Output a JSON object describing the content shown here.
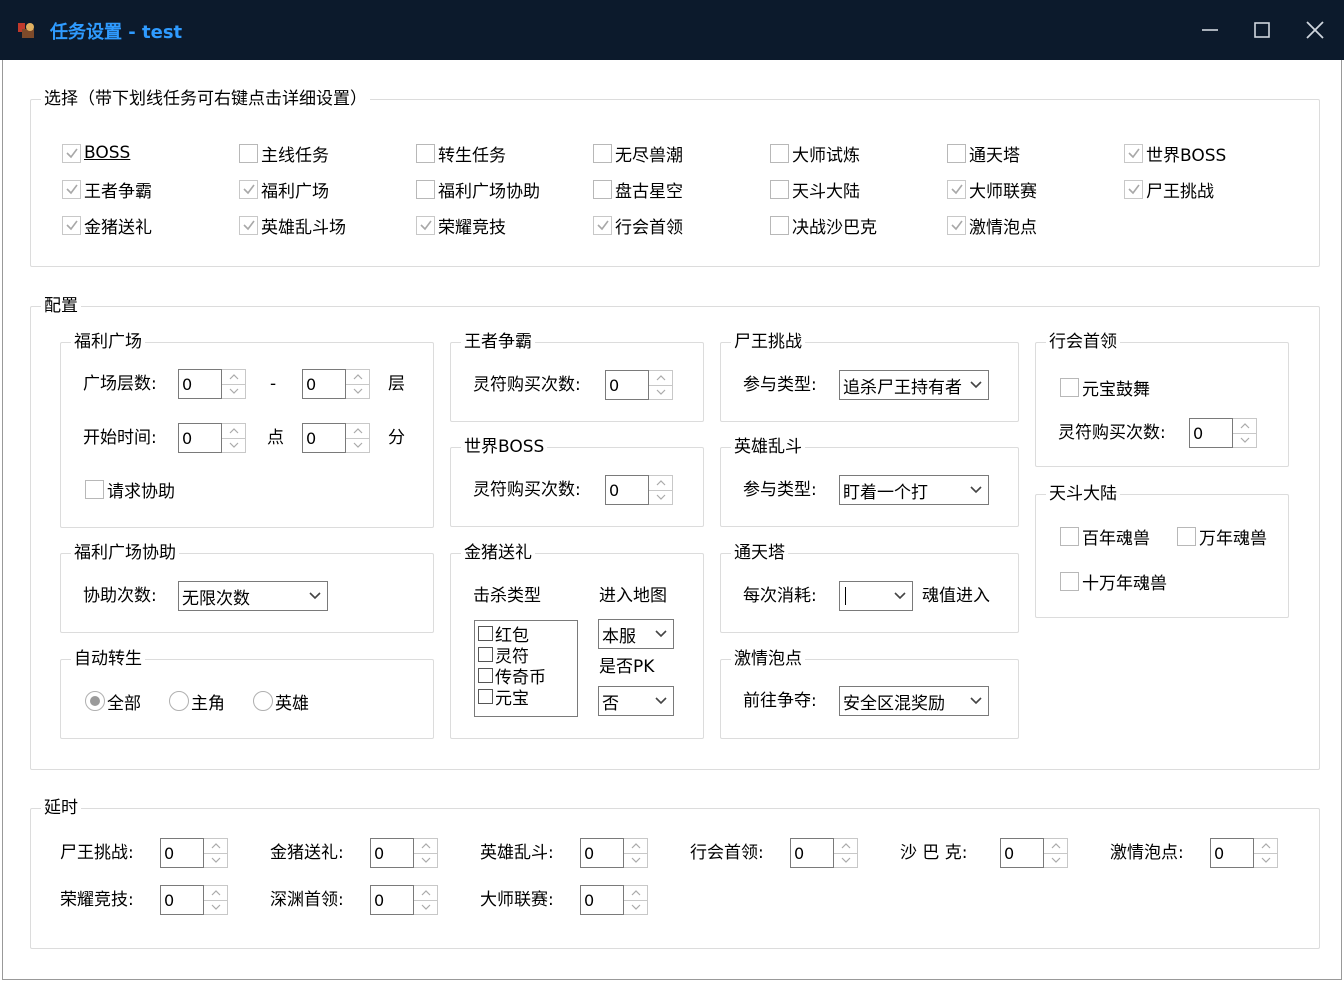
{
  "window": {
    "title": "任务设置 - test",
    "icons": {
      "app": "app-logo-icon",
      "minimize": "minimize-icon",
      "maximize": "maximize-icon",
      "close": "close-icon"
    }
  },
  "select_group": {
    "legend": "选择（带下划线任务可右键点击详细设置）",
    "tasks": [
      {
        "label": "BOSS",
        "checked": true,
        "underline": true
      },
      {
        "label": "主线任务",
        "checked": false
      },
      {
        "label": "转生任务",
        "checked": false
      },
      {
        "label": "无尽兽潮",
        "checked": false
      },
      {
        "label": "大师试炼",
        "checked": false
      },
      {
        "label": "通天塔",
        "checked": false
      },
      {
        "label": "世界BOSS",
        "checked": true
      },
      {
        "label": "王者争霸",
        "checked": true
      },
      {
        "label": "福利广场",
        "checked": true
      },
      {
        "label": "福利广场协助",
        "checked": false
      },
      {
        "label": "盘古星空",
        "checked": false
      },
      {
        "label": "天斗大陆",
        "checked": false
      },
      {
        "label": "大师联赛",
        "checked": true
      },
      {
        "label": "尸王挑战",
        "checked": true
      },
      {
        "label": "金猪送礼",
        "checked": true
      },
      {
        "label": "英雄乱斗场",
        "checked": true
      },
      {
        "label": "荣耀竞技",
        "checked": true
      },
      {
        "label": "行会首领",
        "checked": true
      },
      {
        "label": "决战沙巴克",
        "checked": false
      },
      {
        "label": "激情泡点",
        "checked": true
      }
    ]
  },
  "config_group": {
    "legend": "配置",
    "welfare": {
      "legend": "福利广场",
      "floor_label": "广场层数:",
      "floor_from": "0",
      "dash": "-",
      "floor_to": "0",
      "floor_unit": "层",
      "start_label": "开始时间:",
      "start_hour": "0",
      "hour_unit": "点",
      "start_min": "0",
      "min_unit": "分",
      "request_help": "请求协助"
    },
    "welfare_assist": {
      "legend": "福利广场协助",
      "count_label": "协助次数:",
      "count_value": "无限次数"
    },
    "auto_rebirth": {
      "legend": "自动转生",
      "options": [
        "全部",
        "主角",
        "英雄"
      ],
      "selected": 0
    },
    "king": {
      "legend": "王者争霸",
      "buy_label": "灵符购买次数:",
      "buy_value": "0"
    },
    "world_boss": {
      "legend": "世界BOSS",
      "buy_label": "灵符购买次数:",
      "buy_value": "0"
    },
    "golden_pig": {
      "legend": "金猪送礼",
      "kill_type_label": "击杀类型",
      "map_label": "进入地图",
      "kill_types": [
        "红包",
        "灵符",
        "传奇币",
        "元宝"
      ],
      "map_value": "本服",
      "pk_label": "是否PK",
      "pk_value": "否"
    },
    "corpse_king": {
      "legend": "尸王挑战",
      "type_label": "参与类型:",
      "type_value": "追杀尸王持有者"
    },
    "hero_brawl": {
      "legend": "英雄乱斗",
      "type_label": "参与类型:",
      "type_value": "盯着一个打"
    },
    "tower": {
      "legend": "通天塔",
      "cost_label": "每次消耗:",
      "cost_value": "",
      "suffix": "魂值进入"
    },
    "passion": {
      "legend": "激情泡点",
      "target_label": "前往争夺:",
      "target_value": "安全区混奖励"
    },
    "guild_leader": {
      "legend": "行会首领",
      "ingot_dance": "元宝鼓舞",
      "buy_label": "灵符购买次数:",
      "buy_value": "0"
    },
    "tiandou": {
      "legend": "天斗大陆",
      "options": [
        "百年魂兽",
        "万年魂兽",
        "十万年魂兽"
      ]
    }
  },
  "delay_group": {
    "legend": "延时",
    "items": [
      {
        "label": "尸王挑战:",
        "value": "0"
      },
      {
        "label": "金猪送礼:",
        "value": "0"
      },
      {
        "label": "英雄乱斗:",
        "value": "0"
      },
      {
        "label": "行会首领:",
        "value": "0"
      },
      {
        "label": "沙 巴 克:",
        "value": "0"
      },
      {
        "label": "激情泡点:",
        "value": "0"
      },
      {
        "label": "荣耀竞技:",
        "value": "0"
      },
      {
        "label": "深渊首领:",
        "value": "0"
      },
      {
        "label": "大师联赛:",
        "value": "0"
      }
    ]
  }
}
